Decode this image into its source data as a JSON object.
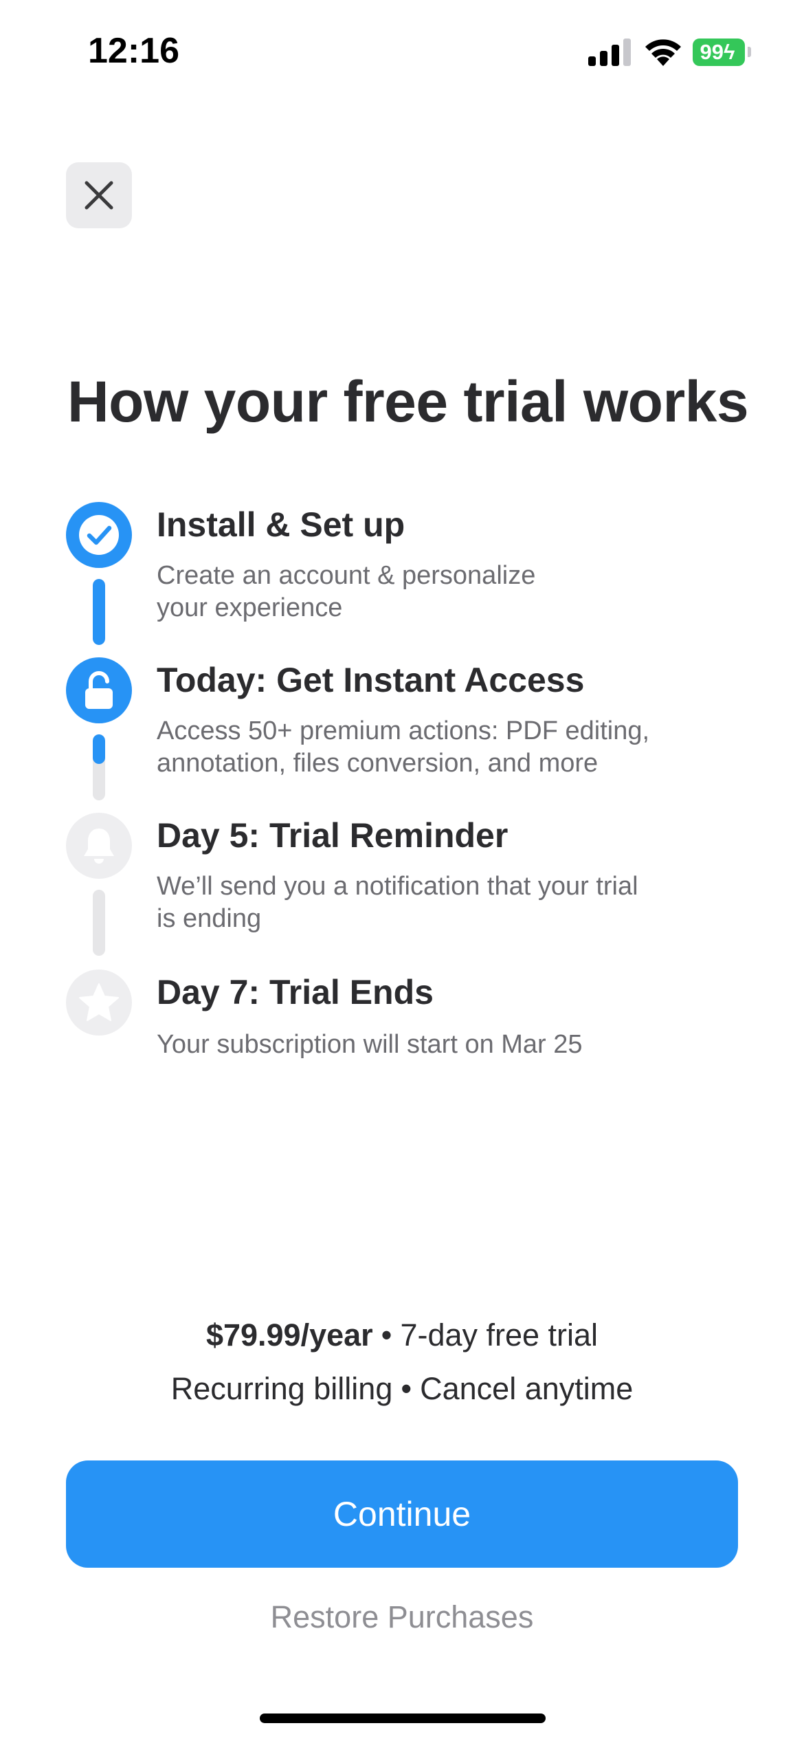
{
  "status_bar": {
    "time": "12:16",
    "battery_level": "99",
    "battery_color": "#34c759",
    "icons": [
      "cellular-signal-icon",
      "wifi-icon",
      "battery-charging-icon"
    ]
  },
  "close_icon": "close-icon",
  "title": "How your free trial works",
  "accent_color": "#2793f5",
  "steps": [
    {
      "icon": "checkmark-icon",
      "state": "completed",
      "title": "Install & Set up",
      "description": "Create an account & personalize\nyour experience",
      "connector_progress": 1.0
    },
    {
      "icon": "unlock-icon",
      "state": "current",
      "title": "Today: Get Instant Access",
      "description": "Access 50+ premium actions: PDF editing,\nannotation, files conversion, and more",
      "connector_progress": 0.45
    },
    {
      "icon": "bell-icon",
      "state": "upcoming",
      "title": "Day 5: Trial Reminder",
      "description": "We’ll send you a notification that your trial\nis ending",
      "connector_progress": 0.0
    },
    {
      "icon": "star-icon",
      "state": "upcoming",
      "title": "Day 7: Trial Ends",
      "description": "Your subscription will start on Mar 25"
    }
  ],
  "pricing": {
    "price": "$79.99/year",
    "separator": "•",
    "trial": "7-day free trial",
    "billing": "Recurring billing",
    "cancel": "Cancel anytime"
  },
  "continue_label": "Continue",
  "restore_label": "Restore Purchases"
}
